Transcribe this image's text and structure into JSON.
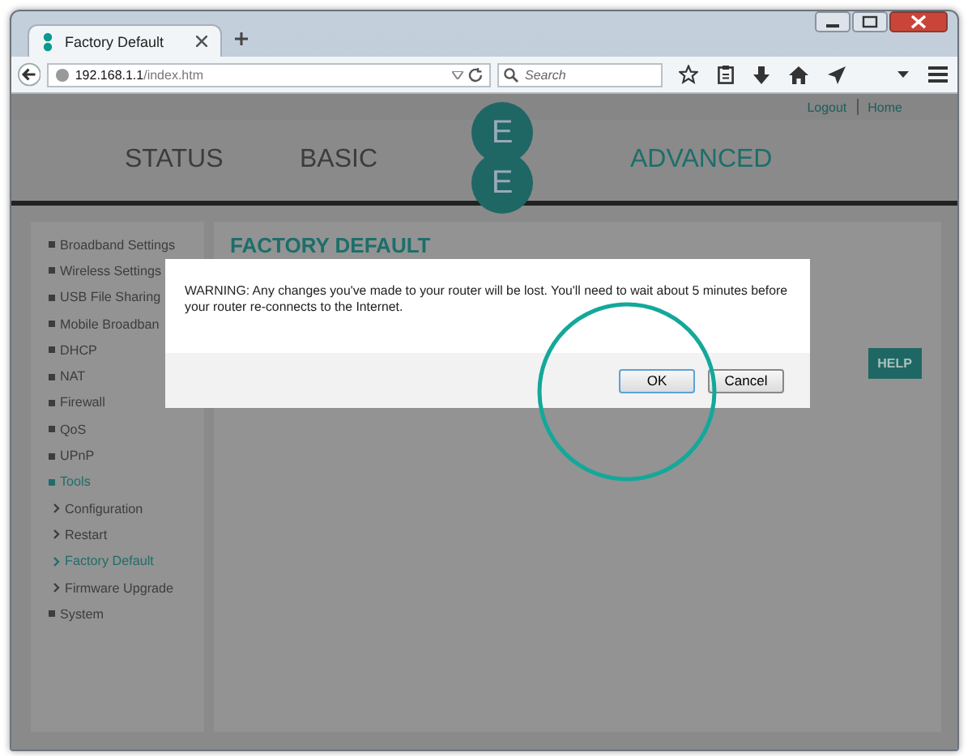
{
  "browser": {
    "tab_title": "Factory Default",
    "url_host": "192.168.1.1",
    "url_path": "/index.htm",
    "search": {
      "placeholder": "Search"
    }
  },
  "header": {
    "links": [
      "Logout",
      "Home"
    ],
    "nav": [
      {
        "label": "STATUS",
        "selected": false
      },
      {
        "label": "BASIC",
        "selected": false
      },
      {
        "label": "ADVANCED",
        "selected": true
      }
    ],
    "logo": [
      "E",
      "E"
    ]
  },
  "sidebar": {
    "items": [
      {
        "label": "Broadband Settings",
        "kind": "top",
        "selected": false
      },
      {
        "label": "Wireless Settings",
        "kind": "top",
        "selected": false
      },
      {
        "label": "USB File Sharing",
        "kind": "top",
        "selected": false
      },
      {
        "label": "Mobile Broadban",
        "kind": "top",
        "selected": false
      },
      {
        "label": "DHCP",
        "kind": "top",
        "selected": false
      },
      {
        "label": "NAT",
        "kind": "top",
        "selected": false
      },
      {
        "label": "Firewall",
        "kind": "top",
        "selected": false
      },
      {
        "label": "QoS",
        "kind": "top",
        "selected": false
      },
      {
        "label": "UPnP",
        "kind": "top",
        "selected": false
      },
      {
        "label": "Tools",
        "kind": "top",
        "selected": true
      },
      {
        "label": "Configuration",
        "kind": "sub",
        "selected": false
      },
      {
        "label": "Restart",
        "kind": "sub",
        "selected": false
      },
      {
        "label": "Factory Default",
        "kind": "sub",
        "selected": true
      },
      {
        "label": "Firmware Upgrade",
        "kind": "sub",
        "selected": false
      },
      {
        "label": "System",
        "kind": "top",
        "selected": false
      }
    ]
  },
  "main": {
    "title": "FACTORY DEFAULT",
    "help": "HELP"
  },
  "dialog": {
    "message": "WARNING: Any changes you've made to your router will be lost. You'll need to wait about 5 minutes before your router re-connects to the Internet.",
    "buttons": [
      "OK",
      "Cancel"
    ]
  }
}
